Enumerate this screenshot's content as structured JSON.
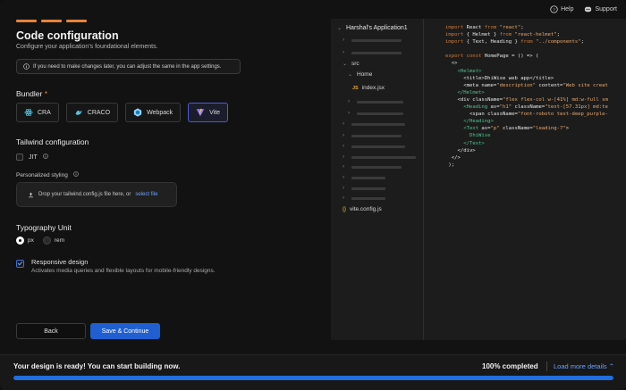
{
  "header": {
    "help_label": "Help",
    "support_label": "Support"
  },
  "steps": {
    "count": 3,
    "color": "#e8833a"
  },
  "page": {
    "title": "Code configuration",
    "subtitle": "Configure your application's foundational elements.",
    "info_text": "If you need to make changes later, you can adjust the same in the app settings."
  },
  "bundler": {
    "label": "Bundler",
    "required_mark": "*",
    "options": [
      {
        "label": "CRA",
        "icon": "react-icon",
        "selected": false
      },
      {
        "label": "CRACO",
        "icon": "craco-icon",
        "selected": false
      },
      {
        "label": "Webpack",
        "icon": "webpack-icon",
        "selected": false
      },
      {
        "label": "Vite",
        "icon": "vite-icon",
        "selected": true
      }
    ]
  },
  "tailwind": {
    "label": "Tailwind configuration",
    "jit_label": "JIT",
    "jit_checked": false,
    "personalized_label": "Personalized styling",
    "drop_text": "Drop your tailwind.config.js file here, or",
    "select_link": "select file"
  },
  "typography": {
    "label": "Typography Unit",
    "options": [
      {
        "label": "px",
        "selected": true
      },
      {
        "label": "rem",
        "selected": false
      }
    ]
  },
  "responsive": {
    "label": "Responsive design",
    "description": "Activates media queries and flexible layouts for mobile-friendly designs.",
    "checked": true
  },
  "actions": {
    "back_label": "Back",
    "save_label": "Save & Continue"
  },
  "file_tree": {
    "root": "Harshal's Application1",
    "src_label": "src",
    "home_label": "Home",
    "index_file": "index.jsx",
    "js_badge": "JS",
    "config_file": "vite.config.js",
    "config_badge": "{}"
  },
  "code_lines": [
    [
      [
        "k",
        "import "
      ],
      [
        "w",
        "React "
      ],
      [
        "k",
        "from "
      ],
      [
        "s",
        "\"react\""
      ],
      [
        "w",
        ";"
      ]
    ],
    [
      [
        "k",
        "import "
      ],
      [
        "w",
        "{ Helmet } "
      ],
      [
        "k",
        "from "
      ],
      [
        "s",
        "\"react-helmet\""
      ],
      [
        "w",
        ";"
      ]
    ],
    [
      [
        "k",
        "import "
      ],
      [
        "w",
        "{ Text, Heading } "
      ],
      [
        "k",
        "from "
      ],
      [
        "s",
        "\"../components\""
      ],
      [
        "w",
        ";"
      ]
    ],
    [
      [
        "w",
        ""
      ]
    ],
    [
      [
        "k",
        "export const "
      ],
      [
        "w",
        "HomePage = () => ("
      ]
    ],
    [
      [
        "w",
        "  <>"
      ]
    ],
    [
      [
        "w",
        "    "
      ],
      [
        "g",
        "<Helmet>"
      ]
    ],
    [
      [
        "w",
        "      <title>DhiWise web app</title>"
      ]
    ],
    [
      [
        "w",
        "      <meta name="
      ],
      [
        "s",
        "\"description\""
      ],
      [
        "w",
        " content="
      ],
      [
        "s",
        "\"Web site creat"
      ]
    ],
    [
      [
        "w",
        "    "
      ],
      [
        "g",
        "</Helmet>"
      ]
    ],
    [
      [
        "w",
        "    <div className="
      ],
      [
        "s",
        "\"flex flex-col w-[41%] md:w-full sm"
      ]
    ],
    [
      [
        "w",
        "      "
      ],
      [
        "g",
        "<Heading"
      ],
      [
        "w",
        " as="
      ],
      [
        "s",
        "\"h1\""
      ],
      [
        "w",
        " className="
      ],
      [
        "s",
        "\"text-[57.31px] md:te"
      ]
    ],
    [
      [
        "w",
        "        <span className="
      ],
      [
        "s",
        "\"font-roboto text-deep_purple-"
      ]
    ],
    [
      [
        "w",
        "      "
      ],
      [
        "g",
        "</Heading>"
      ]
    ],
    [
      [
        "w",
        "      "
      ],
      [
        "g",
        "<Text"
      ],
      [
        "w",
        " as="
      ],
      [
        "s",
        "\"p\""
      ],
      [
        "w",
        " className="
      ],
      [
        "s",
        "\"leading-7\""
      ],
      [
        "w",
        ">"
      ]
    ],
    [
      [
        "w",
        "        "
      ],
      [
        "g",
        "DhiWise"
      ]
    ],
    [
      [
        "w",
        "      "
      ],
      [
        "g",
        "</Text>"
      ]
    ],
    [
      [
        "w",
        "    </div>"
      ]
    ],
    [
      [
        "w",
        "  </>"
      ]
    ],
    [
      [
        "w",
        " );"
      ]
    ]
  ],
  "bottom_bar": {
    "message": "Your design is ready! You can start building now.",
    "percent_label": "100% completed",
    "load_more_label": "Load more details",
    "progress": 1.0,
    "accent": "#1f6fe0"
  }
}
